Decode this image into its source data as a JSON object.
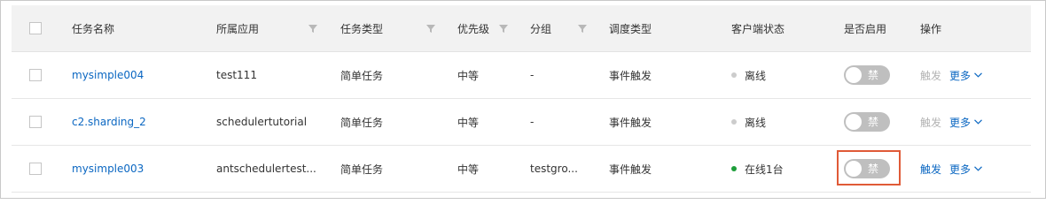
{
  "header": {
    "task_name": "任务名称",
    "app": "所属应用",
    "task_type": "任务类型",
    "priority": "优先级",
    "group": "分组",
    "schedule_type": "调度类型",
    "client_status": "客户端状态",
    "enabled": "是否启用",
    "actions": "操作"
  },
  "rows": [
    {
      "task_name": "mysimple004",
      "app": "test111",
      "task_type": "简单任务",
      "priority": "中等",
      "group": "-",
      "schedule_type": "事件触发",
      "client_status": "离线",
      "client_status_color": "#cccccc",
      "switch_label": "禁",
      "trigger_label": "触发",
      "trigger_enabled": false,
      "more_label": "更多"
    },
    {
      "task_name": "c2.sharding_2",
      "app": "schedulertutorial",
      "task_type": "简单任务",
      "priority": "中等",
      "group": "-",
      "schedule_type": "事件触发",
      "client_status": "离线",
      "client_status_color": "#cccccc",
      "switch_label": "禁",
      "trigger_label": "触发",
      "trigger_enabled": false,
      "more_label": "更多"
    },
    {
      "task_name": "mysimple003",
      "app": "antschedulertest...",
      "task_type": "简单任务",
      "priority": "中等",
      "group": "testgro...",
      "schedule_type": "事件触发",
      "client_status": "在线1台",
      "client_status_color": "#1e9e3a",
      "switch_label": "禁",
      "trigger_label": "触发",
      "trigger_enabled": true,
      "more_label": "更多"
    }
  ],
  "colors": {
    "link": "#0b67c2",
    "header_bg": "#f2f2f2",
    "switch_off": "#bfbfbf",
    "highlight": "#e05a37",
    "online": "#1e9e3a",
    "offline": "#cccccc"
  },
  "icons": {
    "filter": "filter-icon",
    "chevron": "chevron-down-icon"
  }
}
